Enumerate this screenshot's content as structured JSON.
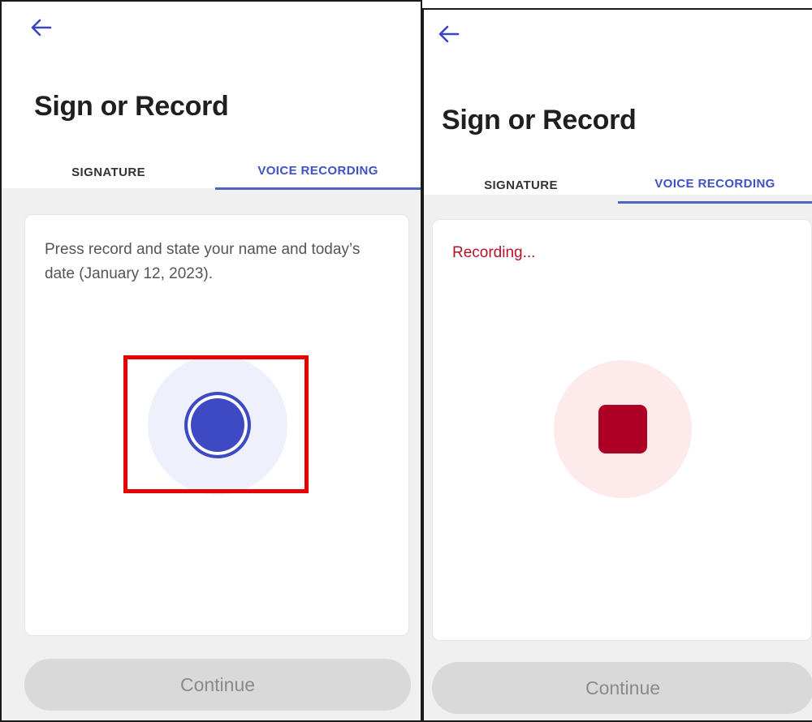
{
  "screens": [
    {
      "header": {
        "back_icon": "arrow-left-icon",
        "title": "Sign or Record"
      },
      "tabs": [
        {
          "label": "SIGNATURE",
          "active": false
        },
        {
          "label": "VOICE RECORDING",
          "active": true
        }
      ],
      "card": {
        "instruction": "Press record and state your name and today’s date (January 12, 2023).",
        "button_icon": "record-icon"
      },
      "continue_label": "Continue"
    },
    {
      "header": {
        "back_icon": "arrow-left-icon",
        "title": "Sign or Record"
      },
      "tabs": [
        {
          "label": "SIGNATURE",
          "active": false
        },
        {
          "label": "VOICE RECORDING",
          "active": true
        }
      ],
      "card": {
        "status": "Recording...",
        "button_icon": "stop-icon"
      },
      "continue_label": "Continue"
    }
  ],
  "colors": {
    "accent": "#3e49c4",
    "recording": "#ad0024",
    "highlight": "#e60000",
    "disabled": "#d9d9d9"
  }
}
